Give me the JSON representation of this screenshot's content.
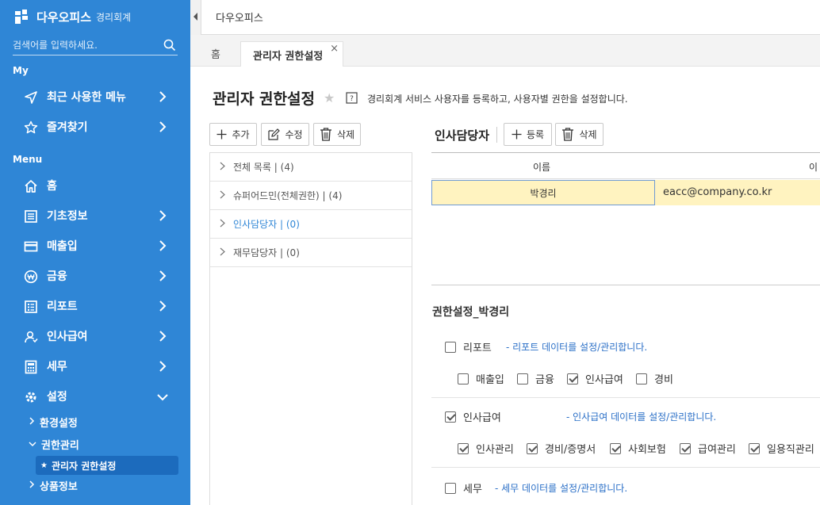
{
  "app": {
    "name": "다우오피스",
    "module": "경리회계"
  },
  "search": {
    "placeholder": "검색어를 입력하세요."
  },
  "sidebar": {
    "section_my": "My",
    "section_menu": "Menu",
    "my_items": [
      {
        "label": "최근 사용한 메뉴",
        "icon": "send-icon"
      },
      {
        "label": "즐겨찾기",
        "icon": "star-icon"
      }
    ],
    "menu_items": [
      {
        "label": "홈",
        "icon": "home-icon"
      },
      {
        "label": "기초정보",
        "icon": "list-icon"
      },
      {
        "label": "매출입",
        "icon": "card-icon"
      },
      {
        "label": "금융",
        "icon": "won-icon"
      },
      {
        "label": "리포트",
        "icon": "report-icon"
      },
      {
        "label": "인사급여",
        "icon": "person-icon"
      },
      {
        "label": "세무",
        "icon": "calculator-icon"
      },
      {
        "label": "설정",
        "icon": "gear-icon"
      }
    ],
    "sub_items": [
      "환경설정",
      "권한관리",
      "관리자 권한설정",
      "상품정보"
    ]
  },
  "topbar": {
    "title": "다우오피스"
  },
  "tabs": {
    "home": "홈",
    "active": "관리자 권한설정",
    "close": "×"
  },
  "page": {
    "title": "관리자 권한설정",
    "description": "경리회계 서비스 사용자를 등록하고, 사용자별 권한을 설정합니다."
  },
  "left_toolbar": {
    "add": "추가",
    "edit": "수정",
    "delete": "삭제"
  },
  "tree": [
    "전체 목록 | (4)",
    "슈퍼어드민(전체권한) | (4)",
    "인사담당자 | (0)",
    "재무담당자 | (0)"
  ],
  "right": {
    "group_title": "인사담당자",
    "register": "등록",
    "delete": "삭제",
    "columns": [
      "이름",
      "이"
    ],
    "rows": [
      {
        "name": "박경리",
        "email": "eacc@company.co.kr"
      }
    ]
  },
  "permissions": {
    "title": "권한설정_박경리",
    "groups": [
      {
        "label": "리포트",
        "checked": false,
        "desc": "- 리포트 데이터를 설정/관리합니다.",
        "items": [
          {
            "label": "매출입",
            "checked": false
          },
          {
            "label": "금융",
            "checked": false
          },
          {
            "label": "인사급여",
            "checked": true
          },
          {
            "label": "경비",
            "checked": false
          }
        ]
      },
      {
        "label": "인사급여",
        "checked": true,
        "desc": "- 인사급여 데이터를 설정/관리합니다.",
        "items": [
          {
            "label": "인사관리",
            "checked": true
          },
          {
            "label": "경비/증명서",
            "checked": true
          },
          {
            "label": "사회보험",
            "checked": true
          },
          {
            "label": "급여관리",
            "checked": true
          },
          {
            "label": "일용직관리",
            "checked": true
          }
        ]
      },
      {
        "label": "세무",
        "checked": false,
        "desc": "- 세무 데이터를 설정/관리합니다.",
        "items": []
      }
    ]
  }
}
